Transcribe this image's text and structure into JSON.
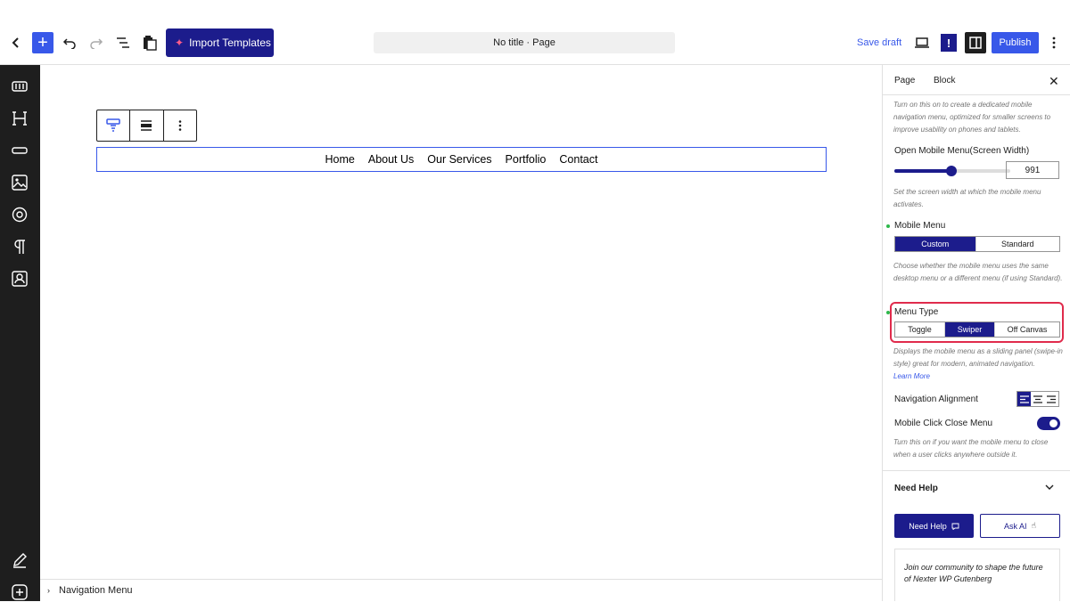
{
  "topbar": {
    "import_label": "Import Templates",
    "doc_title": "No title · Page",
    "save_draft": "Save draft",
    "publish": "Publish",
    "excl": "!"
  },
  "canvas": {
    "nav_items": [
      "Home",
      "About Us",
      "Our Services",
      "Portfolio",
      "Contact"
    ]
  },
  "breadcrumb": {
    "label": "Navigation Menu"
  },
  "panel": {
    "tabs": [
      "Page",
      "Block"
    ],
    "intro_help": "Turn on this on to create a dedicated mobile navigation menu, optimized for smaller screens to improve usability on phones and tablets.",
    "open_mobile_label": "Open Mobile Menu(Screen Width)",
    "open_mobile_value": "991",
    "open_mobile_fraction": 0.49,
    "open_mobile_help": "Set the screen width at which the mobile menu activates.",
    "mobile_menu_label": "Mobile Menu",
    "mobile_menu_options": [
      "Custom",
      "Standard"
    ],
    "mobile_menu_selected": "Custom",
    "mobile_menu_help": "Choose whether the mobile menu uses the same desktop menu or a different menu (if using Standard).",
    "menu_type_label": "Menu Type",
    "menu_type_options": [
      "Toggle",
      "Swiper",
      "Off Canvas"
    ],
    "menu_type_selected": "Swiper",
    "menu_type_help": "Displays the mobile menu as a sliding panel (swipe-in style) great for modern, animated navigation.",
    "learn_more": "Learn More",
    "nav_align_label": "Navigation Alignment",
    "close_menu_label": "Mobile Click Close Menu",
    "close_menu_on": true,
    "close_menu_help": "Turn this on if you want the mobile menu to close when a user clicks anywhere outside it.",
    "need_help_title": "Need Help",
    "need_help_btn": "Need Help",
    "ask_ai_btn": "Ask AI",
    "community_text": "Join our community to shape the future of Nexter WP Gutenberg"
  },
  "colors": {
    "accent": "#3858e9",
    "brand": "#1c1c8c",
    "highlight": "#e02b4c",
    "dot": "#2db84b"
  }
}
